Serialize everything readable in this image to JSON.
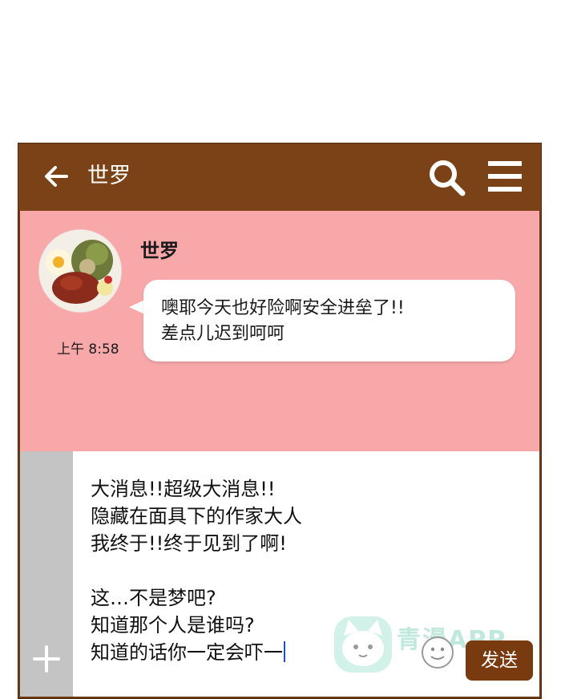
{
  "header": {
    "title": "世罗"
  },
  "message": {
    "sender": "世罗",
    "time": "上午 8:58",
    "text": "噢耶今天也好险啊安全进垒了!!\n差点儿迟到呵呵"
  },
  "composer": {
    "draft": "大消息!!超级大消息!!\n隐藏在面具下的作家大人\n我终于!!终于见到了啊!\n\n这…不是梦吧?\n知道那个人是谁吗?\n知道的话你一定会吓一",
    "send_label": "发送",
    "watermark": "青漫APP"
  },
  "colors": {
    "header": "#7a4216",
    "chat_bg": "#f9a8aa",
    "send_button": "#7a3a10"
  },
  "icons": [
    "back-arrow-icon",
    "search-icon",
    "menu-icon",
    "plus-icon",
    "smiley-icon"
  ]
}
